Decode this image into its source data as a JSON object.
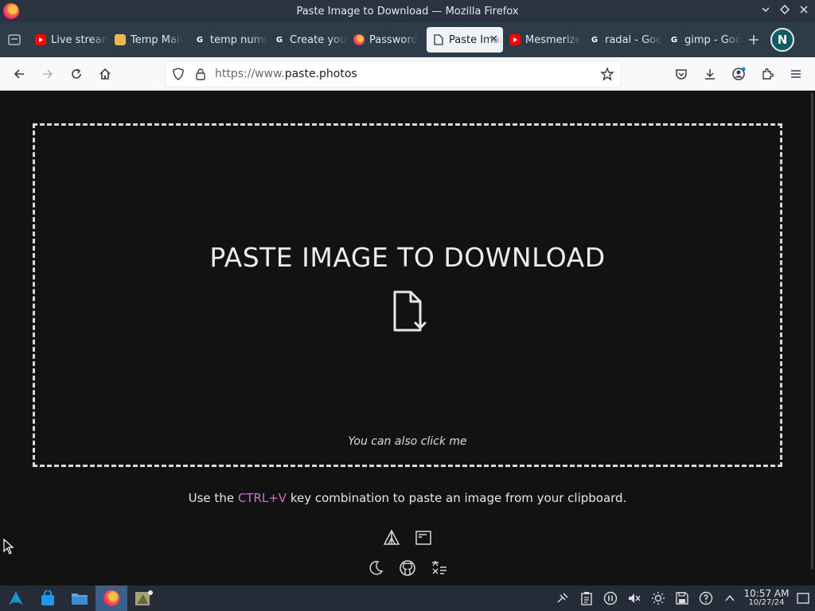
{
  "window": {
    "title": "Paste Image to Download — Mozilla Firefox"
  },
  "tabs": [
    {
      "label": "Live streaming",
      "icon": "youtube-icon",
      "color": "#ff0000"
    },
    {
      "label": "Temp Mail",
      "icon": "mail-icon",
      "color": "#f0b84c"
    },
    {
      "label": "temp number",
      "icon": "google-icon",
      "color": "#ffffff"
    },
    {
      "label": "Create your",
      "icon": "google-icon",
      "color": "#ffffff"
    },
    {
      "label": "Password",
      "icon": "firefox-icon",
      "color": "#ff7139"
    },
    {
      "label": "Paste Image",
      "icon": "document-icon",
      "color": "#333333",
      "active": true
    },
    {
      "label": "Mesmerize",
      "icon": "youtube-icon",
      "color": "#ff0000"
    },
    {
      "label": "radal - Google",
      "icon": "google-icon",
      "color": "#ffffff"
    },
    {
      "label": "gimp - Google",
      "icon": "google-icon",
      "color": "#ffffff"
    }
  ],
  "account": {
    "initial": "N"
  },
  "urlbar": {
    "prefix": "https://www.",
    "domain": "paste.photos"
  },
  "page": {
    "heading": "PASTE IMAGE TO DOWNLOAD",
    "click_me": "You can also click me",
    "hint_before": "Use the ",
    "hint_key": "CTRL+V",
    "hint_after": " key combination to paste an image from your clipboard."
  },
  "taskbar": {
    "time": "10:57 AM",
    "date": "10/27/24"
  },
  "colors": {
    "accent_key": "#d36bd8",
    "bg": "#121212"
  }
}
